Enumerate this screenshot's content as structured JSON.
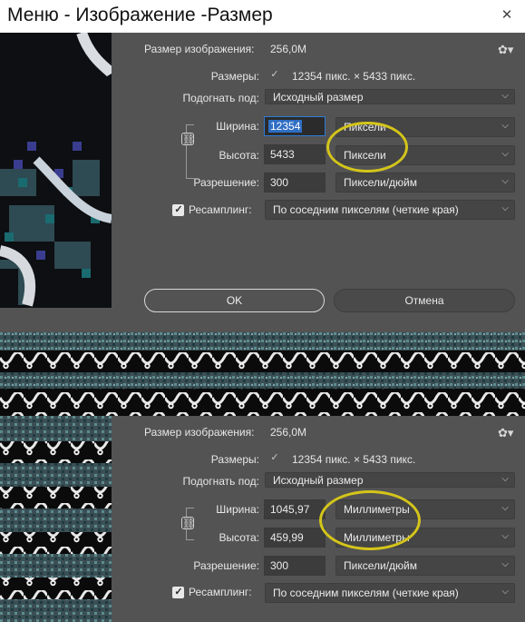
{
  "window": {
    "title": "Меню - Изображение -Размер"
  },
  "top": {
    "image_size_label": "Размер изображения:",
    "image_size_value": "256,0M",
    "dimensions_label": "Размеры:",
    "dimensions_value": "12354 пикс.  ×  5433 пикс.",
    "fit_label": "Подогнать под:",
    "fit_value": "Исходный размер",
    "width_label": "Ширина:",
    "width_value": "12354",
    "width_unit": "Пиксели",
    "height_label": "Высота:",
    "height_value": "5433",
    "height_unit": "Пиксели",
    "resolution_label": "Разрешение:",
    "resolution_value": "300",
    "resolution_unit": "Пиксели/дюйм",
    "resample_label": "Ресамплинг:",
    "resample_value": "По соседним пикселям (четкие края)",
    "ok_label": "OK",
    "cancel_label": "Отмена"
  },
  "bottom": {
    "image_size_label": "Размер изображения:",
    "image_size_value": "256,0M",
    "dimensions_label": "Размеры:",
    "dimensions_value": "12354 пикс.  ×  5433 пикс.",
    "fit_label": "Подогнать под:",
    "fit_value": "Исходный размер",
    "width_label": "Ширина:",
    "width_value": "1045,97",
    "width_unit": "Миллиметры",
    "height_label": "Высота:",
    "height_value": "459,99",
    "height_unit": "Миллиметры",
    "resolution_label": "Разрешение:",
    "resolution_value": "300",
    "resolution_unit": "Пиксели/дюйм",
    "resample_label": "Ресамплинг:",
    "resample_value": "По соседним пикселям (четкие края)"
  },
  "icons": {
    "close": "close-icon",
    "gear": "gear-icon",
    "link": "chain-link-icon",
    "dropdown": "chevron-down-icon",
    "check": "checkmark-icon"
  },
  "colors": {
    "dialog_bg": "#535353",
    "field_bg": "#454545",
    "focus_blue": "#2f6fc4",
    "annotation": "#d4c51a"
  }
}
